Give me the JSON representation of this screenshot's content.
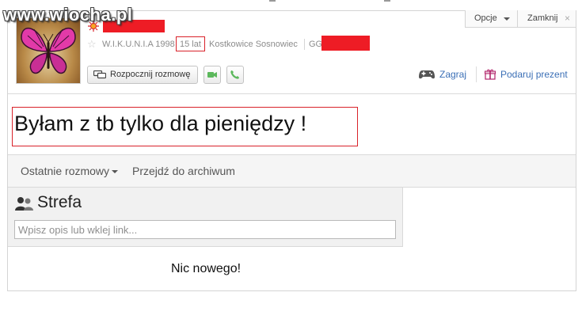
{
  "watermark": "www.wiocha.pl",
  "header": {
    "nick": "W.I.K.U.N.I.A 1998",
    "age": "15 lat",
    "city": "Kostkowice Sosnowiec",
    "gg_label": "GG",
    "talk_button": "Rozpocznij rozmowę",
    "play_link": "Zagraj",
    "gift_link": "Podaruj prezent",
    "options_button": "Opcje",
    "close_button": "Zamknij",
    "close_glyph": "×",
    "star_glyph": "☆"
  },
  "status": {
    "text": "Byłam z tb tylko dla pieniędzy !"
  },
  "tabs": {
    "recent": "Ostatnie rozmowy",
    "archive": "Przejdź do archiwum"
  },
  "strefa": {
    "title": "Strefa",
    "input_placeholder": "Wpisz opis lub wklej link..."
  },
  "feed": {
    "empty_message": "Nic nowego!"
  },
  "colors": {
    "accent_red": "#ee1c25",
    "link_blue": "#3b6fb6",
    "icon_green": "#5cb85c"
  },
  "icons": [
    "status-icon",
    "star-icon",
    "chat-icon",
    "video-icon",
    "phone-icon",
    "gamepad-icon",
    "gift-icon",
    "people-icon",
    "chevron-down-icon",
    "close-icon"
  ]
}
